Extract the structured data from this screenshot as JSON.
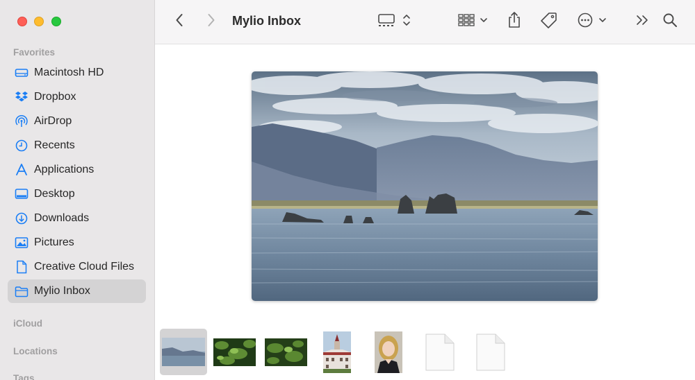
{
  "window": {
    "title": "Mylio Inbox"
  },
  "sidebar": {
    "favorites_label": "Favorites",
    "items": [
      {
        "label": "Macintosh HD",
        "icon": "hard-drive-icon"
      },
      {
        "label": "Dropbox",
        "icon": "dropbox-icon"
      },
      {
        "label": "AirDrop",
        "icon": "airdrop-icon"
      },
      {
        "label": "Recents",
        "icon": "clock-icon"
      },
      {
        "label": "Applications",
        "icon": "applications-icon"
      },
      {
        "label": "Desktop",
        "icon": "desktop-icon"
      },
      {
        "label": "Downloads",
        "icon": "download-icon"
      },
      {
        "label": "Pictures",
        "icon": "pictures-icon"
      },
      {
        "label": "Creative Cloud Files",
        "icon": "document-icon"
      },
      {
        "label": "Mylio Inbox",
        "icon": "folder-icon",
        "selected": true
      }
    ],
    "icloud_label": "iCloud",
    "locations_label": "Locations",
    "tags_label": "Tags"
  },
  "colors": {
    "accent": "#1a7ef5",
    "sidebar_bg": "#e9e7e8",
    "selected_bg": "#d4d3d4"
  },
  "toolbar": {
    "back": "chevron-left-icon",
    "forward": "chevron-right-icon",
    "view": "gallery-view-icon",
    "group": "grid-icon",
    "share": "share-icon",
    "tag": "tag-icon",
    "more": "ellipsis-icon",
    "overflow": "double-chevron-icon",
    "search": "search-icon"
  },
  "gallery": {
    "preview": "mountain-lake-photo",
    "thumbnails": [
      "mountain-lake",
      "green-leaves-1",
      "green-leaves-2",
      "building-tower",
      "portrait-woman",
      "blank-document-1",
      "blank-document-2"
    ]
  }
}
